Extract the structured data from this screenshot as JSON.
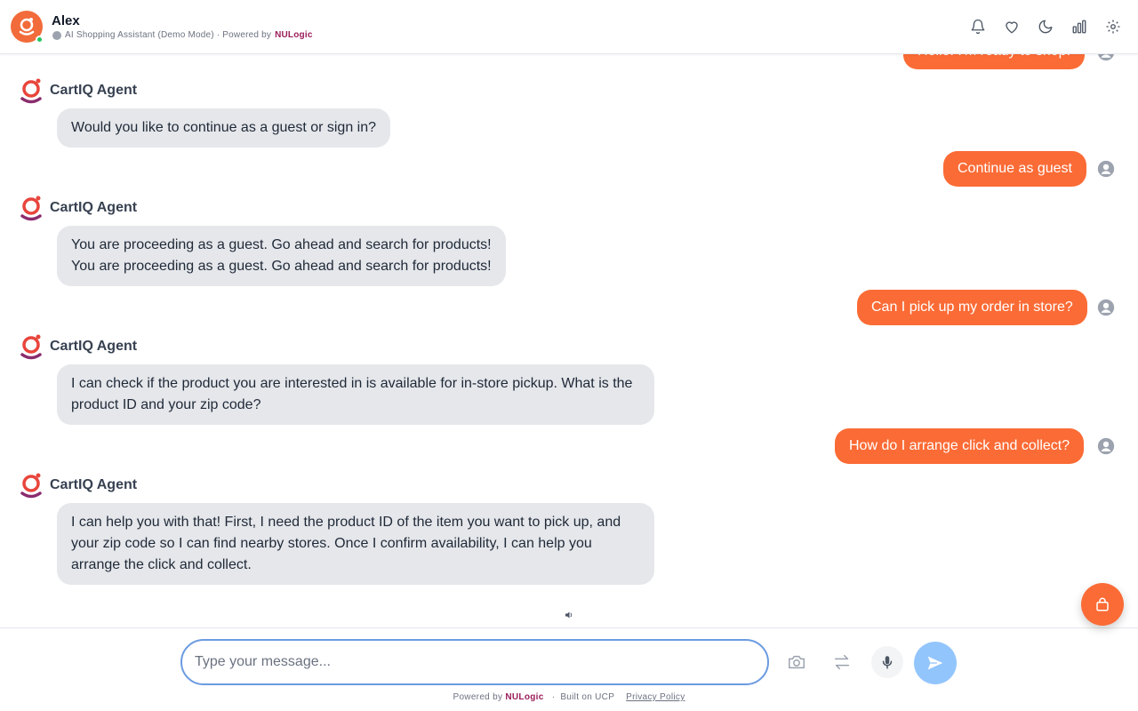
{
  "header": {
    "agent_name": "Alex",
    "subtitle": "AI Shopping Assistant (Demo Mode) · Powered by",
    "brand": "NULogic",
    "status": "online",
    "icons": [
      "bell-icon",
      "heart-icon",
      "moon-icon",
      "bar-chart-icon",
      "gear-icon"
    ]
  },
  "chat": {
    "agent_label": "CartIQ Agent",
    "messages": [
      {
        "role": "user",
        "text": "Hello! I'm ready to shop!"
      },
      {
        "role": "agent",
        "text": "Would you like to continue as a guest or sign in?"
      },
      {
        "role": "user",
        "text": "Continue as guest"
      },
      {
        "role": "agent",
        "line1": "You are proceeding as a guest. Go ahead and search for products!",
        "line2": "You are proceeding as a guest. Go ahead and search for products!"
      },
      {
        "role": "user",
        "text": "Can I pick up my order in store?"
      },
      {
        "role": "agent",
        "text": "I can check if the product you are interested in is available for in-store pickup. What is the product ID and your zip code?"
      },
      {
        "role": "user",
        "text": "How do I arrange click and collect?"
      },
      {
        "role": "agent",
        "text": "I can help you with that! First, I need the product ID of the item you want to pick up, and your zip code so I can find nearby stores. Once I confirm availability, I can help you arrange the click and collect."
      }
    ]
  },
  "composer": {
    "placeholder": "Type your message...",
    "tools": [
      "camera-icon",
      "swap-icon",
      "microphone-icon",
      "send-icon"
    ]
  },
  "footer": {
    "powered_prefix": "Powered by",
    "brand": "NULogic",
    "built_on": "Built on UCP",
    "privacy": "Privacy Policy"
  },
  "colors": {
    "accent": "#fb6b35",
    "brand": "#9a1e5a",
    "agent_bubble": "#e5e7eb",
    "send_button": "#93c5fd",
    "input_border": "#6b9be0"
  }
}
